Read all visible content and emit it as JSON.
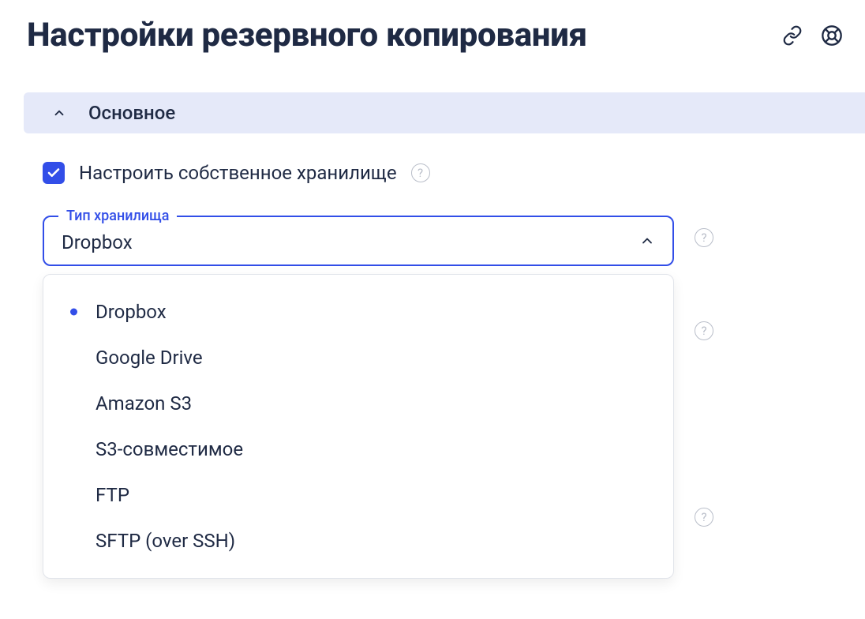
{
  "page_title": "Настройки резервного копирования",
  "icons": {
    "link": "link-icon",
    "support": "lifesaver-icon"
  },
  "accordion": {
    "main_label": "Основное"
  },
  "checkbox": {
    "checked": true,
    "label": "Настроить собственное хранилище"
  },
  "select": {
    "legend": "Тип хранилища",
    "value": "Dropbox",
    "open": true,
    "options": [
      {
        "label": "Dropbox",
        "selected": true
      },
      {
        "label": "Google Drive",
        "selected": false
      },
      {
        "label": "Amazon S3",
        "selected": false
      },
      {
        "label": "S3-совместимое",
        "selected": false
      },
      {
        "label": "FTP",
        "selected": false
      },
      {
        "label": "SFTP (over SSH)",
        "selected": false
      }
    ]
  },
  "help_glyph": "?"
}
